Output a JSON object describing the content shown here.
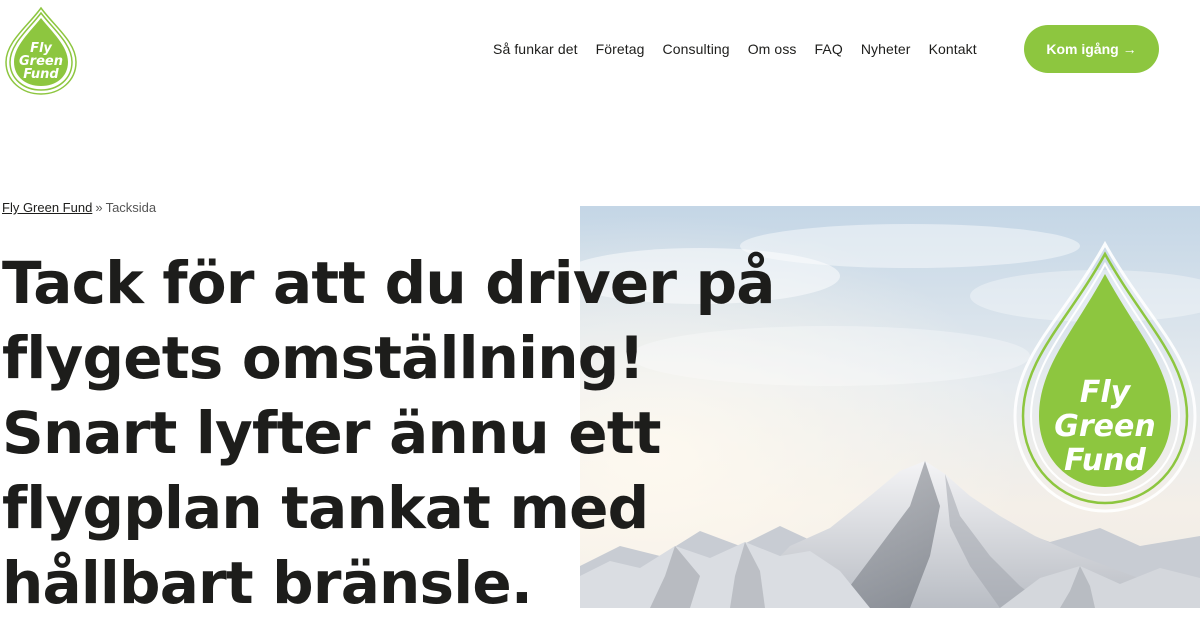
{
  "brand": {
    "logo_line1": "Fly",
    "logo_line2": "Green",
    "logo_line3": "Fund",
    "color_green": "#8dc63f"
  },
  "nav": {
    "items": [
      {
        "label": "Så funkar det"
      },
      {
        "label": "Företag"
      },
      {
        "label": "Consulting"
      },
      {
        "label": "Om oss"
      },
      {
        "label": "FAQ"
      },
      {
        "label": "Nyheter"
      },
      {
        "label": "Kontakt"
      }
    ],
    "cta_label": "Kom igång →"
  },
  "breadcrumb": {
    "home": "Fly Green Fund",
    "separator": "»",
    "current": "Tacksida"
  },
  "headline": {
    "lines": [
      "Tack för att du driver på",
      "flygets omställning!",
      "Snart lyfter ännu ett",
      "flygplan tankat med",
      "hållbart bränsle."
    ]
  },
  "hero": {
    "icon": "mountain-landscape",
    "badge_line1": "Fly",
    "badge_line2": "Green",
    "badge_line3": "Fund"
  }
}
